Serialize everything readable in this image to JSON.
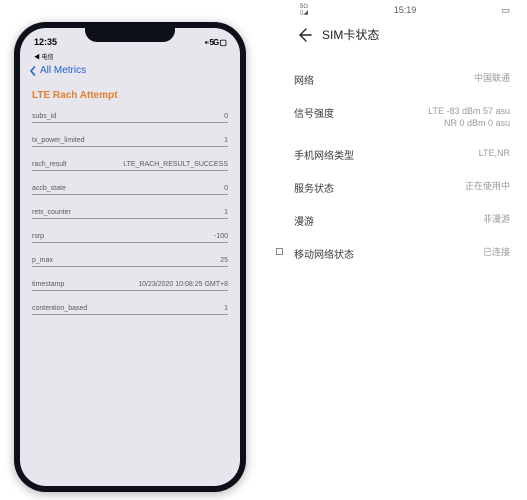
{
  "ios": {
    "status": {
      "time": "12:35",
      "carrier": "◀ 电信",
      "signal": "▪▫ 5G ▢"
    },
    "nav_back": "All Metrics",
    "title": "LTE Rach Attempt",
    "rows": [
      {
        "label": "subs_id",
        "value": "0"
      },
      {
        "label": "tx_power_limited",
        "value": "1"
      },
      {
        "label": "rach_result",
        "value": "LTE_RACH_RESULT_SUCCESS"
      },
      {
        "label": "accb_state",
        "value": "0"
      },
      {
        "label": "retx_counter",
        "value": "1"
      },
      {
        "label": "rsrp",
        "value": "-100"
      },
      {
        "label": "p_max",
        "value": "25"
      },
      {
        "label": "timestamp",
        "value": "10/23/2020 10:08:25 GMT+8"
      },
      {
        "label": "contention_based",
        "value": "1"
      }
    ]
  },
  "android": {
    "status": {
      "left": "5G",
      "time": "15:19",
      "batt": "▭"
    },
    "header": "SIM卡状态",
    "rows": [
      {
        "label": "网络",
        "value": "中国联通"
      },
      {
        "label": "信号强度",
        "value": "LTE -83 dBm   57 asu\nNR 0 dBm   0 asu"
      },
      {
        "label": "手机网络类型",
        "value": "LTE,NR"
      },
      {
        "label": "服务状态",
        "value": "正在使用中"
      },
      {
        "label": "漫游",
        "value": "非漫游"
      },
      {
        "label": "移动网络状态",
        "value": "已连接",
        "icon": true
      }
    ]
  }
}
